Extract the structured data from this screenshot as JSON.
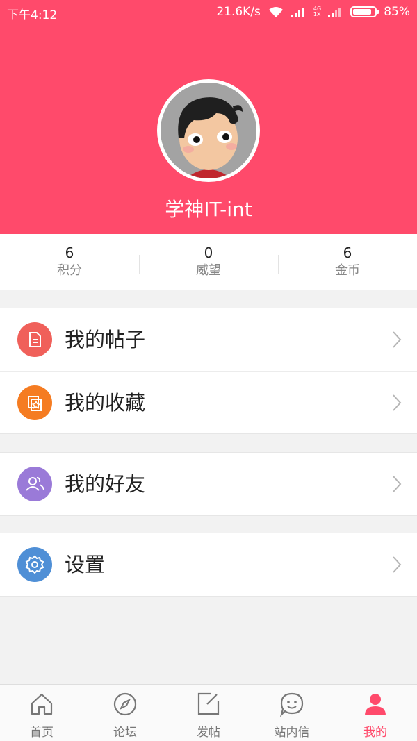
{
  "status_bar": {
    "time": "下午4:12",
    "net_speed": "21.6K/s",
    "net_type": "4G",
    "net_sub": "1X",
    "battery": "85%",
    "battery_level": 0.85
  },
  "profile": {
    "username": "学神IT-int",
    "header_color": "#ff4a6b"
  },
  "stats": [
    {
      "value": "6",
      "label": "积分"
    },
    {
      "value": "0",
      "label": "威望"
    },
    {
      "value": "6",
      "label": "金币"
    }
  ],
  "menu": [
    {
      "label": "我的帖子",
      "icon": "document-icon",
      "color": "#f0605a"
    },
    {
      "label": "我的收藏",
      "icon": "favorites-icon",
      "color": "#f57c22"
    },
    {
      "label": "我的好友",
      "icon": "friends-icon",
      "color": "#9a7ad8"
    },
    {
      "label": "设置",
      "icon": "settings-icon",
      "color": "#4f8fd6"
    }
  ],
  "tabs": [
    {
      "label": "首页",
      "icon": "home-icon"
    },
    {
      "label": "论坛",
      "icon": "compass-icon"
    },
    {
      "label": "发帖",
      "icon": "compose-icon"
    },
    {
      "label": "站内信",
      "icon": "chat-icon"
    },
    {
      "label": "我的",
      "icon": "user-icon",
      "active": true
    }
  ]
}
